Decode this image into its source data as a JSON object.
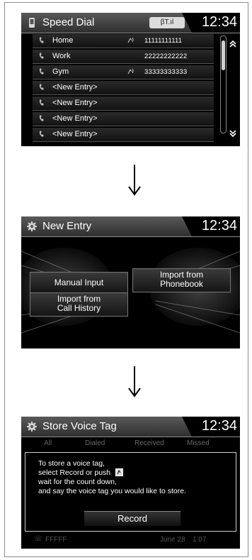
{
  "speed_dial": {
    "title": "Speed Dial",
    "bt_status": "βT.ıl",
    "clock": "12:34",
    "entries": [
      {
        "slot": "1",
        "name": "Home",
        "voice_tag": true,
        "number": "11111111111"
      },
      {
        "slot": "2",
        "name": "Work",
        "voice_tag": false,
        "number": "22222222222"
      },
      {
        "slot": "3",
        "name": "Gym",
        "voice_tag": true,
        "number": "33333333333"
      },
      {
        "slot": "4",
        "name": "<New Entry>",
        "voice_tag": false,
        "number": ""
      },
      {
        "slot": "5",
        "name": "<New Entry>",
        "voice_tag": false,
        "number": ""
      },
      {
        "slot": "6",
        "name": "<New Entry>",
        "voice_tag": false,
        "number": ""
      },
      {
        "slot": "7",
        "name": "<New Entry>",
        "voice_tag": false,
        "number": ""
      }
    ]
  },
  "new_entry": {
    "title": "New Entry",
    "clock": "12:34",
    "manual_input": "Manual Input",
    "import_phonebook": [
      "Import from",
      "Phonebook"
    ],
    "import_call_history": [
      "Import from",
      "Call History"
    ]
  },
  "store_voice_tag": {
    "title": "Store Voice Tag",
    "clock": "12:34",
    "tabs": [
      "All",
      "Dialed",
      "Received",
      "Missed"
    ],
    "message": [
      "To store a voice tag,",
      "select Record or push",
      "wait for the count down,",
      "and say the voice tag you would like to store."
    ],
    "record_label": "Record",
    "background_row": {
      "name": "FFFFF",
      "date": "June 28",
      "time": "1:07"
    }
  },
  "colors": {
    "header": "#4a4a4a",
    "screen_bg": "#000000",
    "frame": "#8c8c8c"
  }
}
